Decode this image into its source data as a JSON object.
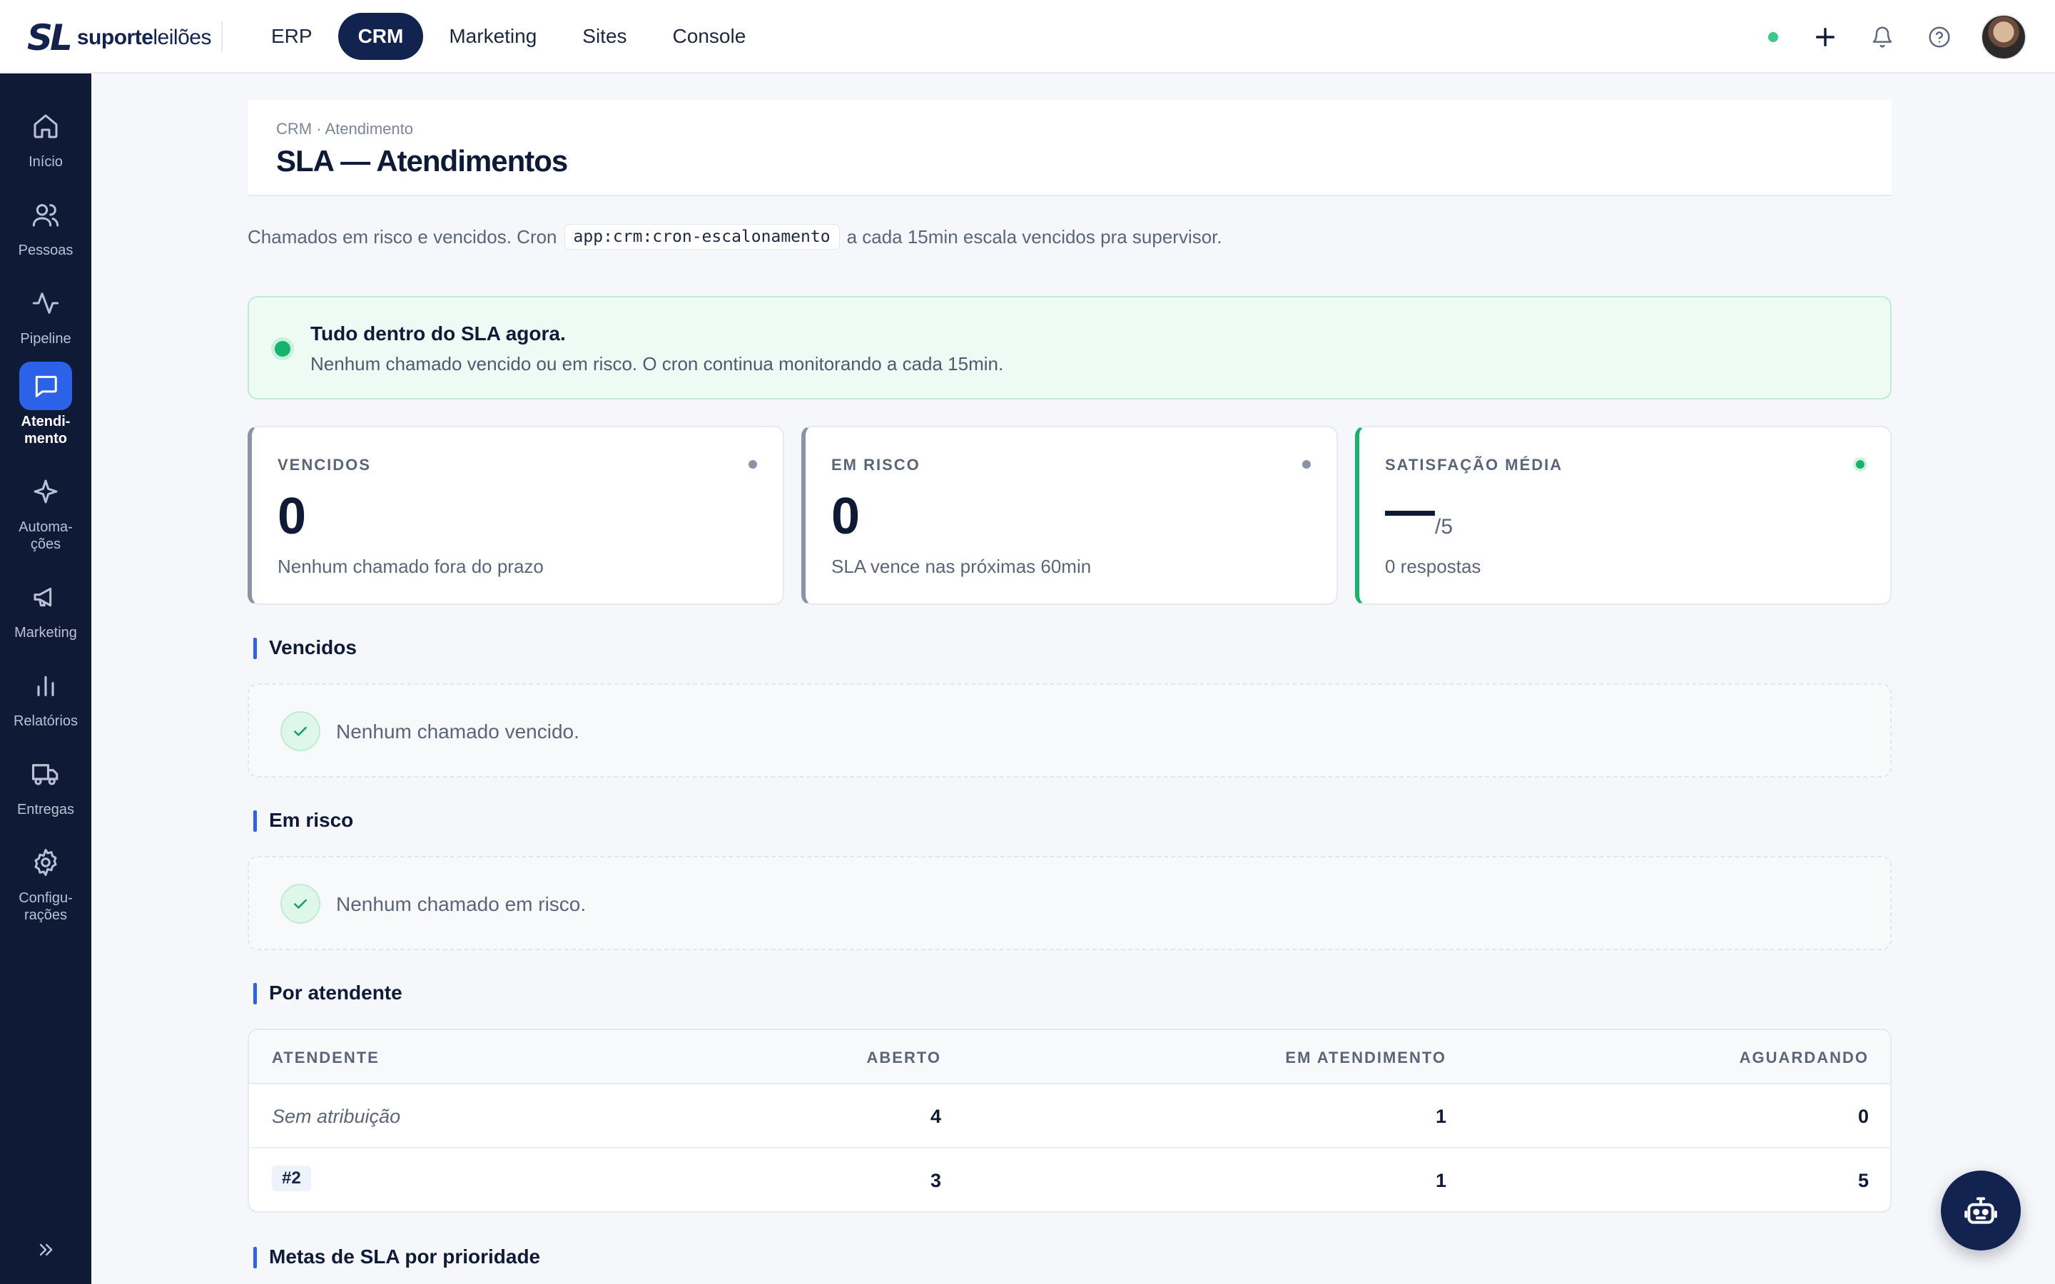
{
  "brand": {
    "mark": "SL",
    "name_bold": "suporte",
    "name_light": "leilões"
  },
  "topnav": [
    {
      "label": "ERP",
      "active": false
    },
    {
      "label": "CRM",
      "active": true
    },
    {
      "label": "Marketing",
      "active": false
    },
    {
      "label": "Sites",
      "active": false
    },
    {
      "label": "Console",
      "active": false
    }
  ],
  "sidebar": {
    "items": [
      {
        "label": "Início",
        "icon": "home-icon"
      },
      {
        "label": "Pessoas",
        "icon": "users-icon"
      },
      {
        "label": "Pipeline",
        "icon": "activity-icon"
      },
      {
        "label": "Atendi-\nmento",
        "icon": "chat-icon",
        "active": true
      },
      {
        "label": "Automa-\nções",
        "icon": "sparkle-icon"
      },
      {
        "label": "Marketing",
        "icon": "megaphone-icon"
      },
      {
        "label": "Relatórios",
        "icon": "bar-chart-icon"
      },
      {
        "label": "Entregas",
        "icon": "truck-icon"
      },
      {
        "label": "Configu-\nrações",
        "icon": "gear-icon"
      }
    ]
  },
  "header": {
    "breadcrumb": "CRM · Atendimento",
    "title": "SLA — Atendimentos"
  },
  "description": {
    "before": "Chamados em risco e vencidos. Cron",
    "code": "app:crm:cron-escalonamento",
    "after": "a cada 15min escala vencidos pra supervisor."
  },
  "alert": {
    "title": "Tudo dentro do SLA agora.",
    "subtitle": "Nenhum chamado vencido ou em risco. O cron continua monitorando a cada 15min."
  },
  "stats": {
    "vencidos": {
      "label": "VENCIDOS",
      "value": "0",
      "sub": "Nenhum chamado fora do prazo"
    },
    "em_risco": {
      "label": "EM RISCO",
      "value": "0",
      "sub": "SLA vence nas próximas 60min"
    },
    "satisfacao": {
      "label": "SATISFAÇÃO MÉDIA",
      "suffix": "/5",
      "sub": "0 respostas"
    }
  },
  "sections": {
    "vencidos": {
      "title": "Vencidos",
      "empty": "Nenhum chamado vencido."
    },
    "em_risco": {
      "title": "Em risco",
      "empty": "Nenhum chamado em risco."
    },
    "por_atendente": {
      "title": "Por atendente"
    },
    "metas": {
      "title": "Metas de SLA por prioridade"
    }
  },
  "table": {
    "columns": [
      "ATENDENTE",
      "ABERTO",
      "EM ATENDIMENTO",
      "AGUARDANDO"
    ],
    "rows": [
      {
        "atendente": "Sem atribuição",
        "aberto": "4",
        "em_atendimento": "1",
        "aguardando": "0"
      },
      {
        "atendente": "#2",
        "aberto": "3",
        "em_atendimento": "1",
        "aguardando": "5"
      }
    ]
  },
  "colors": {
    "navy": "#13234f",
    "sidebar": "#0f1b36",
    "accent": "#2c62e8",
    "success": "#16b36b"
  }
}
